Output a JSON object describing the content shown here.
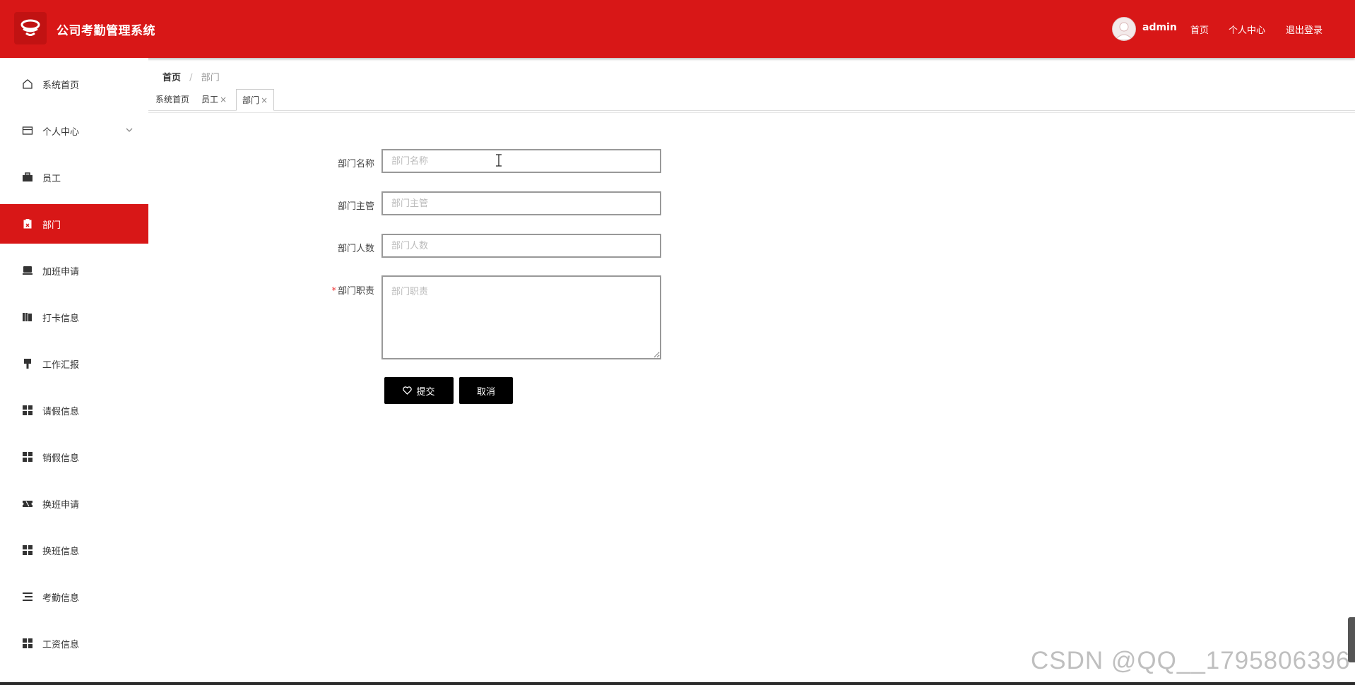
{
  "header": {
    "app_title": "公司考勤管理系统",
    "username": "admin",
    "links": [
      "首页",
      "个人中心",
      "退出登录"
    ]
  },
  "sidebar": {
    "items": [
      {
        "label": "系统首页",
        "icon": "home-icon"
      },
      {
        "label": "个人中心",
        "icon": "wallet-icon"
      },
      {
        "label": "员工",
        "icon": "briefcase-icon"
      },
      {
        "label": "部门",
        "icon": "clipboard-icon"
      },
      {
        "label": "加班申请",
        "icon": "monitor-icon"
      },
      {
        "label": "打卡信息",
        "icon": "books-icon"
      },
      {
        "label": "工作汇报",
        "icon": "brush-icon"
      },
      {
        "label": "请假信息",
        "icon": "grid-icon"
      },
      {
        "label": "销假信息",
        "icon": "grid-icon"
      },
      {
        "label": "换班申请",
        "icon": "ticket-icon"
      },
      {
        "label": "换班信息",
        "icon": "grid-icon"
      },
      {
        "label": "考勤信息",
        "icon": "list-icon"
      },
      {
        "label": "工资信息",
        "icon": "grid-icon"
      }
    ],
    "active_index": 3
  },
  "breadcrumb": {
    "home": "首页",
    "sep": "/",
    "current": "部门"
  },
  "tabs": [
    {
      "label": "系统首页",
      "closable": false
    },
    {
      "label": "员工",
      "closable": true
    },
    {
      "label": "部门",
      "closable": true,
      "active": true
    }
  ],
  "tab_close_glyph": "×",
  "form": {
    "name_label": "部门名称",
    "name_placeholder": "部门名称",
    "manager_label": "部门主管",
    "manager_placeholder": "部门主管",
    "count_label": "部门人数",
    "count_placeholder": "部门人数",
    "required_mark": "*",
    "duty_label": "部门职责",
    "duty_placeholder": "部门职责",
    "submit_label": "提交",
    "cancel_label": "取消"
  },
  "colors": {
    "brand": "#d81717",
    "button": "#000000"
  },
  "watermark": "CSDN @QQ__1795806396"
}
